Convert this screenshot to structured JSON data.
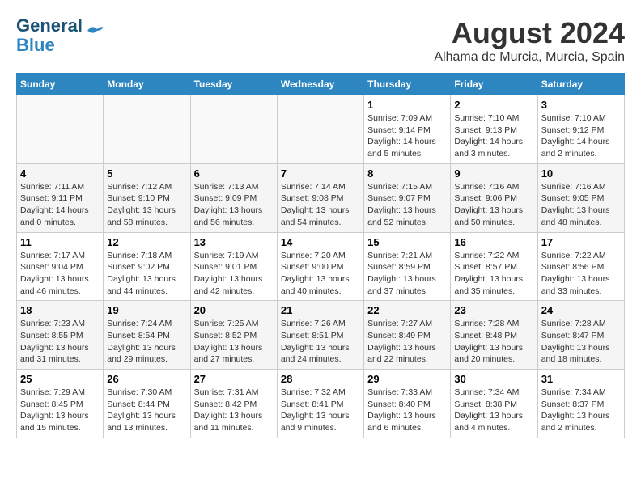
{
  "logo": {
    "line1": "General",
    "line2": "Blue"
  },
  "title": "August 2024",
  "location": "Alhama de Murcia, Murcia, Spain",
  "days_of_week": [
    "Sunday",
    "Monday",
    "Tuesday",
    "Wednesday",
    "Thursday",
    "Friday",
    "Saturday"
  ],
  "weeks": [
    [
      {
        "day": "",
        "info": ""
      },
      {
        "day": "",
        "info": ""
      },
      {
        "day": "",
        "info": ""
      },
      {
        "day": "",
        "info": ""
      },
      {
        "day": "1",
        "info": "Sunrise: 7:09 AM\nSunset: 9:14 PM\nDaylight: 14 hours\nand 5 minutes."
      },
      {
        "day": "2",
        "info": "Sunrise: 7:10 AM\nSunset: 9:13 PM\nDaylight: 14 hours\nand 3 minutes."
      },
      {
        "day": "3",
        "info": "Sunrise: 7:10 AM\nSunset: 9:12 PM\nDaylight: 14 hours\nand 2 minutes."
      }
    ],
    [
      {
        "day": "4",
        "info": "Sunrise: 7:11 AM\nSunset: 9:11 PM\nDaylight: 14 hours\nand 0 minutes."
      },
      {
        "day": "5",
        "info": "Sunrise: 7:12 AM\nSunset: 9:10 PM\nDaylight: 13 hours\nand 58 minutes."
      },
      {
        "day": "6",
        "info": "Sunrise: 7:13 AM\nSunset: 9:09 PM\nDaylight: 13 hours\nand 56 minutes."
      },
      {
        "day": "7",
        "info": "Sunrise: 7:14 AM\nSunset: 9:08 PM\nDaylight: 13 hours\nand 54 minutes."
      },
      {
        "day": "8",
        "info": "Sunrise: 7:15 AM\nSunset: 9:07 PM\nDaylight: 13 hours\nand 52 minutes."
      },
      {
        "day": "9",
        "info": "Sunrise: 7:16 AM\nSunset: 9:06 PM\nDaylight: 13 hours\nand 50 minutes."
      },
      {
        "day": "10",
        "info": "Sunrise: 7:16 AM\nSunset: 9:05 PM\nDaylight: 13 hours\nand 48 minutes."
      }
    ],
    [
      {
        "day": "11",
        "info": "Sunrise: 7:17 AM\nSunset: 9:04 PM\nDaylight: 13 hours\nand 46 minutes."
      },
      {
        "day": "12",
        "info": "Sunrise: 7:18 AM\nSunset: 9:02 PM\nDaylight: 13 hours\nand 44 minutes."
      },
      {
        "day": "13",
        "info": "Sunrise: 7:19 AM\nSunset: 9:01 PM\nDaylight: 13 hours\nand 42 minutes."
      },
      {
        "day": "14",
        "info": "Sunrise: 7:20 AM\nSunset: 9:00 PM\nDaylight: 13 hours\nand 40 minutes."
      },
      {
        "day": "15",
        "info": "Sunrise: 7:21 AM\nSunset: 8:59 PM\nDaylight: 13 hours\nand 37 minutes."
      },
      {
        "day": "16",
        "info": "Sunrise: 7:22 AM\nSunset: 8:57 PM\nDaylight: 13 hours\nand 35 minutes."
      },
      {
        "day": "17",
        "info": "Sunrise: 7:22 AM\nSunset: 8:56 PM\nDaylight: 13 hours\nand 33 minutes."
      }
    ],
    [
      {
        "day": "18",
        "info": "Sunrise: 7:23 AM\nSunset: 8:55 PM\nDaylight: 13 hours\nand 31 minutes."
      },
      {
        "day": "19",
        "info": "Sunrise: 7:24 AM\nSunset: 8:54 PM\nDaylight: 13 hours\nand 29 minutes."
      },
      {
        "day": "20",
        "info": "Sunrise: 7:25 AM\nSunset: 8:52 PM\nDaylight: 13 hours\nand 27 minutes."
      },
      {
        "day": "21",
        "info": "Sunrise: 7:26 AM\nSunset: 8:51 PM\nDaylight: 13 hours\nand 24 minutes."
      },
      {
        "day": "22",
        "info": "Sunrise: 7:27 AM\nSunset: 8:49 PM\nDaylight: 13 hours\nand 22 minutes."
      },
      {
        "day": "23",
        "info": "Sunrise: 7:28 AM\nSunset: 8:48 PM\nDaylight: 13 hours\nand 20 minutes."
      },
      {
        "day": "24",
        "info": "Sunrise: 7:28 AM\nSunset: 8:47 PM\nDaylight: 13 hours\nand 18 minutes."
      }
    ],
    [
      {
        "day": "25",
        "info": "Sunrise: 7:29 AM\nSunset: 8:45 PM\nDaylight: 13 hours\nand 15 minutes."
      },
      {
        "day": "26",
        "info": "Sunrise: 7:30 AM\nSunset: 8:44 PM\nDaylight: 13 hours\nand 13 minutes."
      },
      {
        "day": "27",
        "info": "Sunrise: 7:31 AM\nSunset: 8:42 PM\nDaylight: 13 hours\nand 11 minutes."
      },
      {
        "day": "28",
        "info": "Sunrise: 7:32 AM\nSunset: 8:41 PM\nDaylight: 13 hours\nand 9 minutes."
      },
      {
        "day": "29",
        "info": "Sunrise: 7:33 AM\nSunset: 8:40 PM\nDaylight: 13 hours\nand 6 minutes."
      },
      {
        "day": "30",
        "info": "Sunrise: 7:34 AM\nSunset: 8:38 PM\nDaylight: 13 hours\nand 4 minutes."
      },
      {
        "day": "31",
        "info": "Sunrise: 7:34 AM\nSunset: 8:37 PM\nDaylight: 13 hours\nand 2 minutes."
      }
    ]
  ]
}
